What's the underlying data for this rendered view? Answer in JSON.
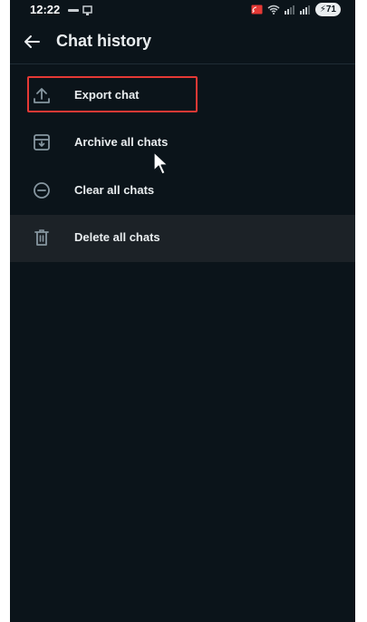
{
  "status_bar": {
    "time": "12:22",
    "battery": "71"
  },
  "header": {
    "title": "Chat history"
  },
  "menu": {
    "items": [
      {
        "label": "Export chat",
        "icon": "export-upload-icon"
      },
      {
        "label": "Archive all chats",
        "icon": "archive-icon"
      },
      {
        "label": "Clear all chats",
        "icon": "clear-minus-circle-icon"
      },
      {
        "label": "Delete all chats",
        "icon": "trash-icon"
      }
    ]
  },
  "colors": {
    "background": "#0b141a",
    "text": "#e9edef",
    "icon": "#8696a0",
    "highlight": "#e53935",
    "pressed_row": "#1c2227"
  }
}
